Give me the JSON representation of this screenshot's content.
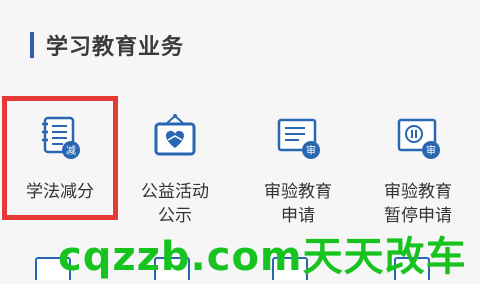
{
  "section": {
    "title": "学习教育业务"
  },
  "items": [
    {
      "label_line1": "学法减分",
      "label_line2": "",
      "badge": "减",
      "icon": "notebook-icon"
    },
    {
      "label_line1": "公益活动",
      "label_line2": "公示",
      "badge": "",
      "icon": "heart-frame-icon"
    },
    {
      "label_line1": "审验教育",
      "label_line2": "申请",
      "badge": "审",
      "icon": "document-icon"
    },
    {
      "label_line1": "审验教育",
      "label_line2": "暂停申请",
      "badge": "审",
      "icon": "pause-document-icon"
    }
  ],
  "watermark": {
    "text": "cqzzb.com天天改车"
  },
  "colors": {
    "accent": "#2f5fa5",
    "badge": "#2a67b3",
    "highlight": "#e53935",
    "watermark": "#17c41f"
  }
}
